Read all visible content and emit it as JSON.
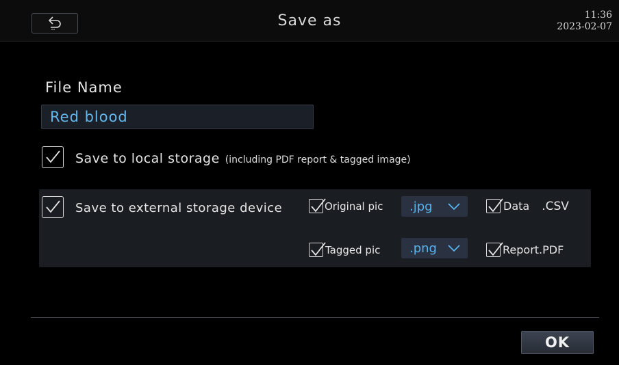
{
  "header": {
    "title": "Save as",
    "time": "11:36",
    "date": "2023-02-07",
    "back_icon": "return-arrow-icon"
  },
  "file_name": {
    "label": "File Name",
    "value": "Red blood"
  },
  "local_storage": {
    "label": "Save to local storage",
    "note": "(including PDF report & tagged image)",
    "checked": true
  },
  "external_storage": {
    "label": "Save to external storage device",
    "checked": true,
    "options": {
      "original_pic": {
        "label": "Original pic",
        "checked": true,
        "format": ".jpg"
      },
      "data": {
        "label": "Data",
        "suffix": ".CSV",
        "checked": true
      },
      "tagged_pic": {
        "label": "Tagged pic",
        "checked": true,
        "format": ".png"
      },
      "report": {
        "label": "Report.PDF",
        "checked": true
      }
    }
  },
  "footer": {
    "ok_label": "OK"
  },
  "colors": {
    "background": "#000000",
    "panel": "#1a1d22",
    "accent_text": "#5ab4ee",
    "dropdown_bg": "#2a3140"
  }
}
